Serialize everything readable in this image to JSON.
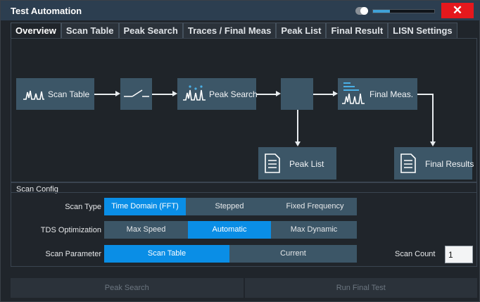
{
  "window": {
    "title": "Test Automation",
    "close_label": "✕",
    "progress_fraction": 0.28
  },
  "tabs": [
    {
      "label": "Overview",
      "active": true
    },
    {
      "label": "Scan Table",
      "active": false
    },
    {
      "label": "Peak Search",
      "active": false
    },
    {
      "label": "Traces / Final Meas",
      "active": false
    },
    {
      "label": "Peak List",
      "active": false
    },
    {
      "label": "Final Result",
      "active": false
    },
    {
      "label": "LISN Settings",
      "active": false
    }
  ],
  "flow": {
    "scan_table": "Scan Table",
    "peak_search": "Peak Search",
    "final_meas": "Final Meas.",
    "peak_list": "Peak List",
    "final_results": "Final Results"
  },
  "scan_config": {
    "title": "Scan Config",
    "scan_type": {
      "label": "Scan Type",
      "options": [
        "Time Domain (FFT)",
        "Stepped",
        "Fixed Frequency"
      ],
      "selected": "Time Domain (FFT)"
    },
    "tds_optimization": {
      "label": "TDS Optimization",
      "options": [
        "Max Speed",
        "Automatic",
        "Max Dynamic"
      ],
      "selected": "Automatic"
    },
    "scan_parameter": {
      "label": "Scan Parameter",
      "options": [
        "Scan Table",
        "Current"
      ],
      "selected": "Scan Table"
    },
    "scan_count": {
      "label": "Scan Count",
      "value": "1"
    }
  },
  "buttons": {
    "peak_search": "Peak Search",
    "run_final_test": "Run Final Test"
  },
  "colors": {
    "accent": "#0a8ee6",
    "box": "#3c5667",
    "close": "#e5181d"
  }
}
